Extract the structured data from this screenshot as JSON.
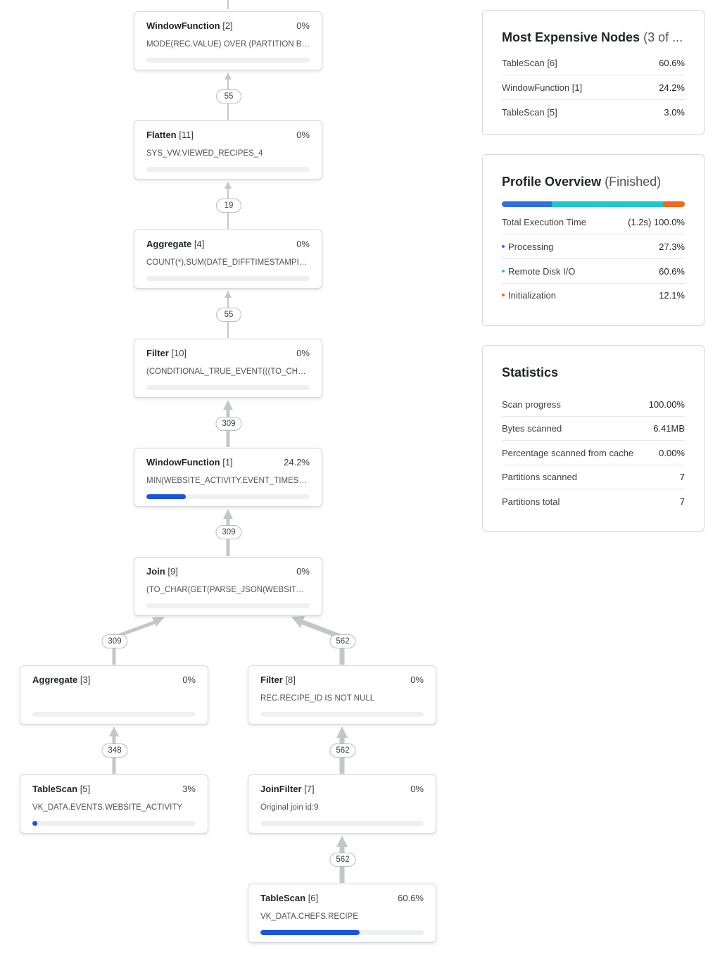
{
  "nodes": {
    "n2": {
      "name": "WindowFunction",
      "id": "[2]",
      "pct": "0%",
      "expr": "MODE(REC.VALUE) OVER (PARTITION BY REC.RECIPE_ID)",
      "fill": 0
    },
    "n11": {
      "name": "Flatten",
      "id": "[11]",
      "pct": "0%",
      "expr": "SYS_VW.VIEWED_RECIPES_4",
      "fill": 0
    },
    "n4": {
      "name": "Aggregate",
      "id": "[4]",
      "pct": "0%",
      "expr": "COUNT(*),SUM(DATE_DIFFTIMESTAMPINSECONDS)",
      "fill": 0
    },
    "n10": {
      "name": "Filter",
      "id": "[10]",
      "pct": "0%",
      "expr": "(CONDITIONAL_TRUE_EVENT(((TO_CHAR(GET(PARSE_JSON",
      "fill": 0
    },
    "n1": {
      "name": "WindowFunction",
      "id": "[1]",
      "pct": "24.2%",
      "expr": "MIN(WEBSITE_ACTIVITY.EVENT_TIMESTAMP)",
      "fill": 0.242
    },
    "n9": {
      "name": "Join",
      "id": "[9]",
      "pct": "0%",
      "expr": "(TO_CHAR(GET(PARSE_JSON(WEBSITE_ACTIVITY.EVENT_DETAILS",
      "fill": 0
    },
    "n3": {
      "name": "Aggregate",
      "id": "[3]",
      "pct": "0%",
      "expr": "",
      "fill": 0
    },
    "n8": {
      "name": "Filter",
      "id": "[8]",
      "pct": "0%",
      "expr": "REC.RECIPE_ID IS NOT NULL",
      "fill": 0
    },
    "n5": {
      "name": "TableScan",
      "id": "[5]",
      "pct": "3%",
      "expr": "VK_DATA.EVENTS.WEBSITE_ACTIVITY",
      "fill": 0.03
    },
    "n7": {
      "name": "JoinFilter",
      "id": "[7]",
      "pct": "0%",
      "expr": "Original join id:9",
      "fill": 0
    },
    "n6": {
      "name": "TableScan",
      "id": "[6]",
      "pct": "60.6%",
      "expr": "VK_DATA.CHEFS.RECIPE",
      "fill": 0.606
    }
  },
  "edges": {
    "e_11_2": "55",
    "e_4_11": "19",
    "e_10_4": "55",
    "e_1_10": "309",
    "e_9_1": "309",
    "e_3_9": "309",
    "e_8_9": "562",
    "e_5_3": "348",
    "e_7_8": "562",
    "e_6_7": "562"
  },
  "expensive": {
    "title": "Most Expensive Nodes",
    "subtitle": "(3 of ...",
    "rows": [
      {
        "label": "TableScan [6]",
        "value": "60.6%"
      },
      {
        "label": "WindowFunction [1]",
        "value": "24.2%"
      },
      {
        "label": "TableScan [5]",
        "value": "3.0%"
      }
    ]
  },
  "overview": {
    "title": "Profile Overview",
    "subtitle": "(Finished)",
    "total_label": "Total Execution Time",
    "total_value": "(1.2s) 100.0%",
    "segments": [
      {
        "label": "Processing",
        "value": "27.3%",
        "fraction": 0.273,
        "color": "#2f6fe4"
      },
      {
        "label": "Remote Disk I/O",
        "value": "60.6%",
        "fraction": 0.606,
        "color": "#21c6c6"
      },
      {
        "label": "Initialization",
        "value": "12.1%",
        "fraction": 0.121,
        "color": "#f06a1a"
      }
    ]
  },
  "statistics": {
    "title": "Statistics",
    "rows": [
      {
        "label": "Scan progress",
        "value": "100.00%"
      },
      {
        "label": "Bytes scanned",
        "value": "6.41MB"
      },
      {
        "label": "Percentage scanned from cache",
        "value": "0.00%"
      },
      {
        "label": "Partitions scanned",
        "value": "7"
      },
      {
        "label": "Partitions total",
        "value": "7"
      }
    ]
  },
  "colors": {
    "accent": "#1a56db",
    "edge": "#c4c7ca"
  }
}
